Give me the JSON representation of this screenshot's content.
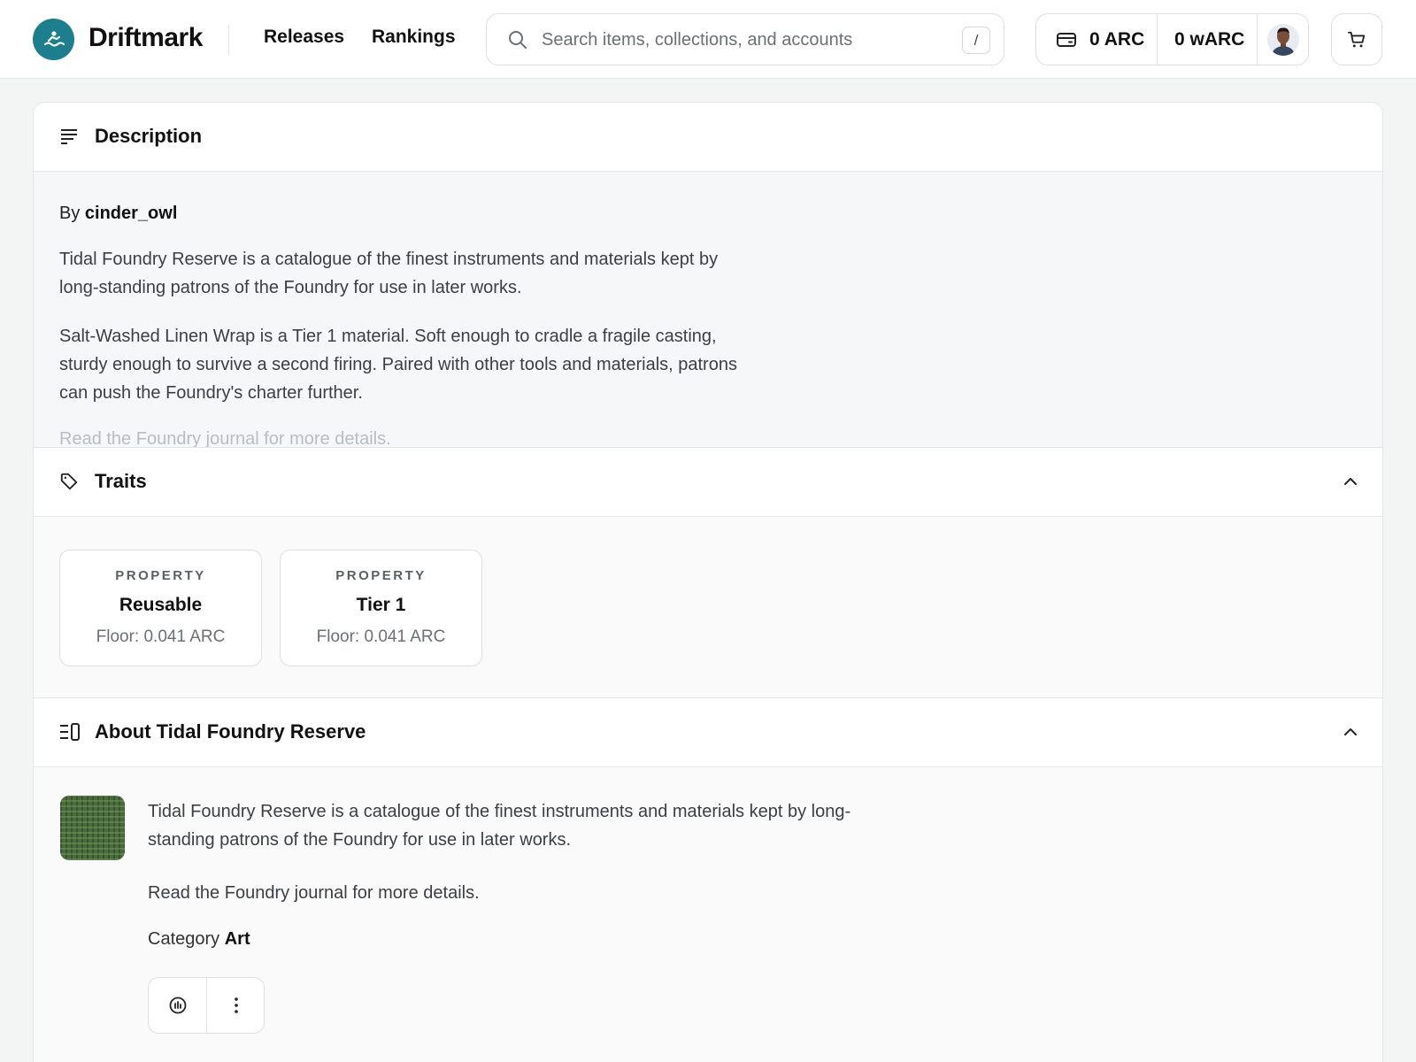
{
  "header": {
    "brand": "Driftmark",
    "nav": {
      "releases": "Releases",
      "rankings": "Rankings"
    },
    "search": {
      "placeholder": "Search items, collections, and accounts",
      "shortcut": "/"
    },
    "wallet": {
      "arc": "0 ARC",
      "warc": "0 wARC"
    }
  },
  "description": {
    "title": "Description",
    "by_prefix": "By",
    "creator": "cinder_owl",
    "para1": "Tidal Foundry Reserve is a catalogue of the finest instruments and materials kept by long-standing patrons of the Foundry for use in later works.",
    "para2": "Salt-Washed Linen Wrap is a Tier 1 material. Soft enough to cradle a fragile casting, sturdy enough to survive a second firing. Paired with other tools and materials, patrons can push the Foundry's charter further.",
    "para3": "Read the Foundry journal for more details."
  },
  "traits": {
    "title": "Traits",
    "items": [
      {
        "type": "PROPERTY",
        "value": "Reusable",
        "floor": "Floor: 0.041 ARC"
      },
      {
        "type": "PROPERTY",
        "value": "Tier 1",
        "floor": "Floor: 0.041 ARC"
      }
    ]
  },
  "about": {
    "title": "About Tidal Foundry Reserve",
    "para1": "Tidal Foundry Reserve is a catalogue of the finest instruments and materials kept by long-standing patrons of the Foundry for use in later works.",
    "para2": "Read the Foundry journal for more details.",
    "category_label": "Category",
    "category_value": "Art"
  },
  "colors": {
    "brand": "#1d7f8e",
    "text": "#111111",
    "muted": "#6b7075"
  },
  "icons": {
    "logo": "wave-person-icon",
    "search": "search-icon",
    "wallet": "wallet-icon",
    "cart": "cart-icon",
    "description": "lines-icon",
    "traits": "tag-icon",
    "about": "list-panel-icon",
    "collapse": "chevron-up-icon",
    "stats": "activity-icon",
    "more": "more-vertical-icon"
  }
}
